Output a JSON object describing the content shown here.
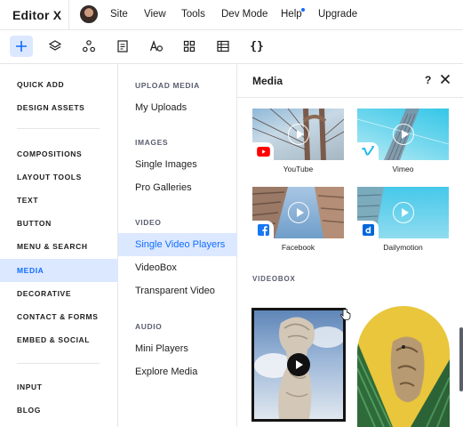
{
  "app": {
    "logo": "Editor X",
    "logo_main": "Editor",
    "logo_x": "X"
  },
  "topbar": {
    "menu": [
      "Site",
      "View",
      "Tools",
      "Dev Mode",
      "Help",
      "Upgrade"
    ]
  },
  "toolbar": {
    "tools": [
      {
        "name": "add",
        "active": true
      },
      {
        "name": "layers"
      },
      {
        "name": "components"
      },
      {
        "name": "pages"
      },
      {
        "name": "typography"
      },
      {
        "name": "apps"
      },
      {
        "name": "tables"
      },
      {
        "name": "code",
        "label": "{}"
      }
    ]
  },
  "categories": {
    "group1": [
      "QUICK ADD",
      "DESIGN ASSETS"
    ],
    "group2": [
      "COMPOSITIONS",
      "LAYOUT TOOLS",
      "TEXT",
      "BUTTON",
      "MENU & SEARCH",
      "MEDIA",
      "DECORATIVE",
      "CONTACT & FORMS",
      "EMBED & SOCIAL"
    ],
    "group3": [
      "INPUT",
      "BLOG"
    ],
    "active": "MEDIA"
  },
  "media_menu": {
    "upload_media": {
      "title": "UPLOAD MEDIA",
      "items": [
        "My Uploads"
      ]
    },
    "images": {
      "title": "IMAGES",
      "items": [
        "Single Images",
        "Pro Galleries"
      ]
    },
    "video": {
      "title": "VIDEO",
      "items": [
        "Single Video Players",
        "VideoBox",
        "Transparent Video"
      ]
    },
    "audio": {
      "title": "AUDIO",
      "items": [
        "Mini Players",
        "Explore Media"
      ]
    },
    "active": "Single Video Players"
  },
  "panel": {
    "title": "Media",
    "help": "?",
    "video_players": [
      {
        "label": "YouTube",
        "brand_color": "#ff0000"
      },
      {
        "label": "Vimeo",
        "brand_color": "#1ab7ea"
      },
      {
        "label": "Facebook",
        "brand_color": "#1877f2"
      },
      {
        "label": "Dailymotion",
        "brand_color": "#0066dc"
      }
    ],
    "videobox_title": "VIDEOBOX"
  },
  "colors": {
    "accent": "#116dff",
    "active_bg": "#dce8ff",
    "help_dot": "#116dff"
  }
}
